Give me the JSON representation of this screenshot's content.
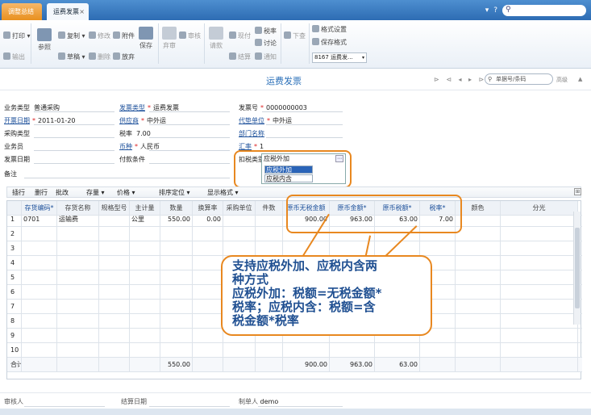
{
  "tabs": [
    {
      "label": "调整总结",
      "active": false
    },
    {
      "label": "运费发票",
      "active": true
    }
  ],
  "tab_close": "×",
  "top_right": {
    "dropdown": "▾",
    "help": "?",
    "search_placeholder": ""
  },
  "toolbar": {
    "print": "打印",
    "copy": "复制",
    "modify": "修改",
    "attach": "附件",
    "save": "保存",
    "audit": "审核",
    "abandon_audit": "弃审",
    "ref": "参照",
    "draft": "草稿",
    "delete": "删除",
    "discard": "放弃",
    "output": "输出",
    "request": "请款",
    "pay_now": "现付",
    "settle": "结算",
    "discuss": "讨论",
    "notify": "通知",
    "push_down": "下查",
    "format_set": "格式设置",
    "save_format": "保存格式",
    "format_value": "8167 运费发..."
  },
  "page": {
    "title": "运费发票",
    "search_placeholder": "单据号/条码",
    "advanced": "高级",
    "nav": "⊳ ⊲ ◂ ▸ ⊳"
  },
  "header": {
    "business_type": {
      "label": "业务类型",
      "value": "普通采购"
    },
    "invoice_type": {
      "label": "发票类型",
      "value": "运费发票"
    },
    "invoice_no": {
      "label": "发票号",
      "value": "0000000003"
    },
    "invoice_date": {
      "label": "开票日期",
      "value": "2011-01-20"
    },
    "supplier": {
      "label": "供应商",
      "value": "中外运"
    },
    "pay_unit": {
      "label": "代垫单位",
      "value": "中外运"
    },
    "purchase_type": {
      "label": "采购类型",
      "value": ""
    },
    "tax_rate": {
      "label": "税率",
      "value": "7.00"
    },
    "dept": {
      "label": "部门名称",
      "value": ""
    },
    "salesman": {
      "label": "业务员",
      "value": ""
    },
    "currency": {
      "label": "币种",
      "value": "人民币"
    },
    "exchange_rate": {
      "label": "汇率",
      "value": "1"
    },
    "send_date": {
      "label": "发票日期",
      "value": ""
    },
    "pay_terms": {
      "label": "付款条件",
      "value": ""
    },
    "tax_type": {
      "label": "扣税类别",
      "value": "应税外加"
    },
    "remark": {
      "label": "备注",
      "value": ""
    }
  },
  "tax_options": [
    "应税外加",
    "应税内含"
  ],
  "grid_toolbar": [
    "插行",
    "删行",
    "批改",
    "存量",
    "价格",
    "排序定位",
    "显示格式"
  ],
  "grid_toolbar_arrow": "▾",
  "grid": {
    "columns": [
      "",
      "存货编码*",
      "存货名称",
      "规格型号",
      "主计量",
      "数量",
      "换算率",
      "采购单位",
      "件数",
      "原币无税金额",
      "原币金额*",
      "原币税额*",
      "税率*",
      "颜色",
      "分光"
    ],
    "rows": [
      [
        "1",
        "0701",
        "运输费",
        "",
        "公里",
        "550.00",
        "0.00",
        "",
        "",
        "900.00",
        "963.00",
        "63.00",
        "7.00",
        "",
        ""
      ],
      [
        "2",
        "",
        "",
        "",
        "",
        "",
        "",
        "",
        "",
        "",
        "",
        "",
        "",
        "",
        ""
      ],
      [
        "3",
        "",
        "",
        "",
        "",
        "",
        "",
        "",
        "",
        "",
        "",
        "",
        "",
        "",
        ""
      ],
      [
        "4",
        "",
        "",
        "",
        "",
        "",
        "",
        "",
        "",
        "",
        "",
        "",
        "",
        "",
        ""
      ],
      [
        "5",
        "",
        "",
        "",
        "",
        "",
        "",
        "",
        "",
        "",
        "",
        "",
        "",
        "",
        ""
      ],
      [
        "6",
        "",
        "",
        "",
        "",
        "",
        "",
        "",
        "",
        "",
        "",
        "",
        "",
        "",
        ""
      ],
      [
        "7",
        "",
        "",
        "",
        "",
        "",
        "",
        "",
        "",
        "",
        "",
        "",
        "",
        "",
        ""
      ],
      [
        "8",
        "",
        "",
        "",
        "",
        "",
        "",
        "",
        "",
        "",
        "",
        "",
        "",
        "",
        ""
      ],
      [
        "9",
        "",
        "",
        "",
        "",
        "",
        "",
        "",
        "",
        "",
        "",
        "",
        "",
        "",
        ""
      ],
      [
        "10",
        "",
        "",
        "",
        "",
        "",
        "",
        "",
        "",
        "",
        "",
        "",
        "",
        "",
        ""
      ]
    ],
    "total": [
      "合计",
      "",
      "",
      "",
      "",
      "550.00",
      "",
      "",
      "",
      "900.00",
      "963.00",
      "63.00",
      "",
      "",
      ""
    ]
  },
  "callout": "支持应税外加、应税内含两\n种方式\n应税外加：税额=无税金额*\n税率；应税内含：税额=含\n税金额*税率",
  "footer": {
    "auditor": {
      "label": "审核人",
      "value": ""
    },
    "settle_date": {
      "label": "结算日期",
      "value": ""
    },
    "maker": {
      "label": "制单人",
      "value": "demo"
    }
  },
  "colors": {
    "accent": "#2a6fb8",
    "highlight": "#e88820",
    "selected": "#2a64b8"
  }
}
